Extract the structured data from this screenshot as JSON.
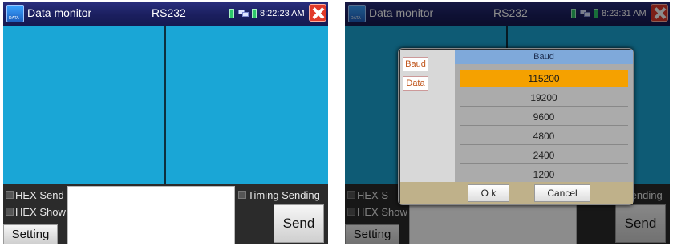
{
  "left_screen": {
    "title": "Data monitor",
    "mode": "RS232",
    "time": "8:22:23 AM",
    "checkboxes": {
      "hex_send": "HEX Send",
      "hex_show": "HEX Show",
      "timing_sending": "Timing Sending"
    },
    "buttons": {
      "setting": "Setting",
      "send": "Send"
    }
  },
  "right_screen": {
    "title": "Data monitor",
    "mode": "RS232",
    "time": "8:23:31 AM",
    "checkboxes": {
      "hex_send": "HEX S",
      "hex_show": "HEX Show",
      "timing_sending": "Sending"
    },
    "buttons": {
      "setting": "Setting",
      "send": "Send"
    },
    "dialog": {
      "side_tabs": [
        "Baud",
        "Data"
      ],
      "header": "Baud",
      "options": [
        "115200",
        "19200",
        "9600",
        "4800",
        "2400",
        "1200"
      ],
      "selected_option": "115200",
      "ok_label": "O k",
      "cancel_label": "Cancel"
    }
  },
  "colors": {
    "data_area": "#1aa6d6",
    "title_bar": "#1b1f5f",
    "selected_option": "#f5a100",
    "close_button": "#e23a2a"
  },
  "icons": {
    "app": "data-app-icon",
    "battery": "battery-icon",
    "network": "network-icon",
    "close": "close-icon"
  }
}
